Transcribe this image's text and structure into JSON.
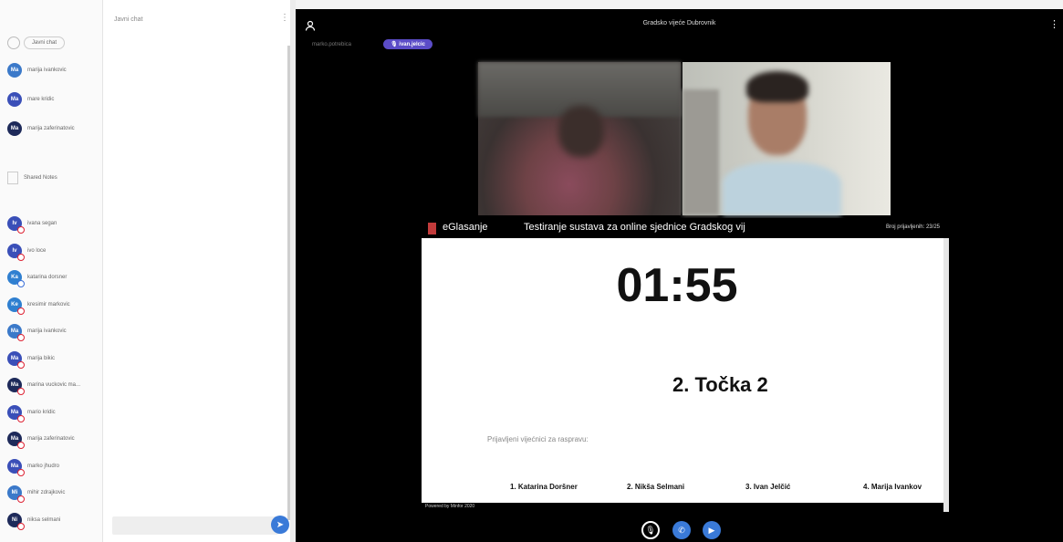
{
  "sidebar": {
    "messages_header": "",
    "public_chat": "Javni chat",
    "messages": [
      {
        "initials": "Ma",
        "name": "marija ivankovic",
        "color": "#3b79c9"
      },
      {
        "initials": "Ma",
        "name": "mare kridic",
        "color": "#3a4fb8"
      },
      {
        "initials": "Ma",
        "name": "marija zaferinatovic",
        "color": "#1e2a5a"
      }
    ],
    "notes_header": "",
    "shared_notes": "Shared Notes",
    "users_header": "",
    "users": [
      {
        "initials": "Iv",
        "name": "ivana segan",
        "color": "#3a4fb8",
        "status": "red"
      },
      {
        "initials": "Iv",
        "name": "ivo loce",
        "color": "#3a4fb8",
        "status": "red"
      },
      {
        "initials": "Ka",
        "name": "katarina dorsner",
        "color": "#2f7fd0",
        "status": "blue"
      },
      {
        "initials": "Ke",
        "name": "kresimir markovic",
        "color": "#2f7fd0",
        "status": "red"
      },
      {
        "initials": "Ma",
        "name": "marija ivankovic",
        "color": "#3b79c9",
        "status": "red"
      },
      {
        "initials": "Ma",
        "name": "marija bikic",
        "color": "#3a4fb8",
        "status": "red"
      },
      {
        "initials": "Ma",
        "name": "marina vuckovic ma...",
        "color": "#1e2a5a",
        "status": "red"
      },
      {
        "initials": "Ma",
        "name": "mario kridic",
        "color": "#3a4fb8",
        "status": "red"
      },
      {
        "initials": "Ma",
        "name": "marija zaferinatovic",
        "color": "#1e2a5a",
        "status": "red"
      },
      {
        "initials": "Ma",
        "name": "marko jhudro",
        "color": "#3a4fb8",
        "status": "red"
      },
      {
        "initials": "Mi",
        "name": "mihir zdrajkovic",
        "color": "#3b79c9",
        "status": "red"
      },
      {
        "initials": "Ni",
        "name": "niksa selmani",
        "color": "#1e2a5a",
        "status": "red"
      }
    ]
  },
  "chat": {
    "title": "Javni chat",
    "faint": "",
    "input_placeholder": ""
  },
  "main": {
    "meeting_title": "Gradsko vijeće Dubrovnik",
    "talking": [
      "marko.potrebica",
      "ivan.jelcic"
    ]
  },
  "presentation": {
    "brand": "eGlasanje",
    "title": "Testiranje sustava za online sjednice Gradskog vij",
    "broj": "Broj prijavljenih: 23/25",
    "timer": "01:55",
    "agenda_item": "2. Točka 2",
    "speakers_label": "Prijavljeni vijećnici za raspravu:",
    "speakers": [
      "1. Katarina Doršner",
      "2. Nikša Selmani",
      "3. Ivan Jelčić",
      "4. Marija Ivankov"
    ],
    "powered": "Powered by Minfor 2020"
  },
  "icons": {
    "send": "send-icon",
    "mic": "mic-muted-icon",
    "phone": "phone-icon",
    "camera": "camera-icon",
    "user": "user-icon"
  },
  "colors": {
    "accent": "#3a7ad8",
    "talking_chip": "#5b4cc7"
  }
}
